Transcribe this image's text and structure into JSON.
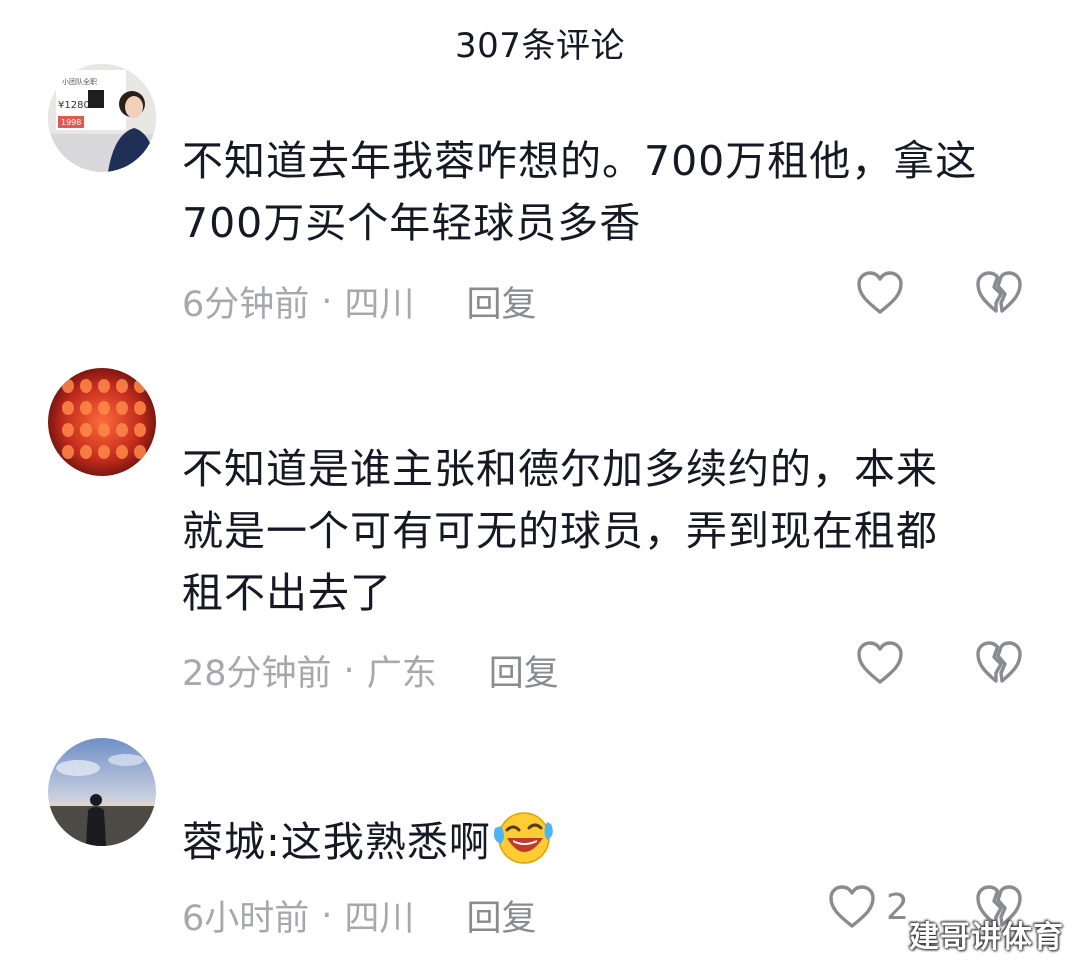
{
  "header": {
    "title": "307条评论"
  },
  "comments": [
    {
      "username": "",
      "text_lines": [
        "不知道去年我蓉咋想的。700万租他，拿这",
        "700万买个年轻球员多香"
      ],
      "time": "6分钟前",
      "separator": "·",
      "location": "四川",
      "reply_label": "回复",
      "like_count": "",
      "avatar_poster_text": [
        "小团队全职",
        "¥1280",
        "1998"
      ]
    },
    {
      "username": "",
      "text_lines": [
        "不知道是谁主张和德尔加多续约的，本来",
        "就是一个可有可无的球员，弄到现在租都",
        "租不出去了"
      ],
      "time": "28分钟前",
      "separator": "·",
      "location": "广东",
      "reply_label": "回复",
      "like_count": ""
    },
    {
      "username": "",
      "text_lines": [
        "蓉城:这我熟悉啊"
      ],
      "time": "6小时前",
      "separator": "·",
      "location": "四川",
      "reply_label": "回复",
      "like_count": "2"
    }
  ],
  "icons": {
    "like": "heart-outline-icon",
    "dislike": "broken-heart-outline-icon",
    "emoji": "laughing-tears-emoji"
  },
  "colors": {
    "primary_text": "#161823",
    "secondary_text": "#a7a8ad",
    "icon_stroke": "#8a8b91"
  },
  "watermark": "建哥讲体育"
}
